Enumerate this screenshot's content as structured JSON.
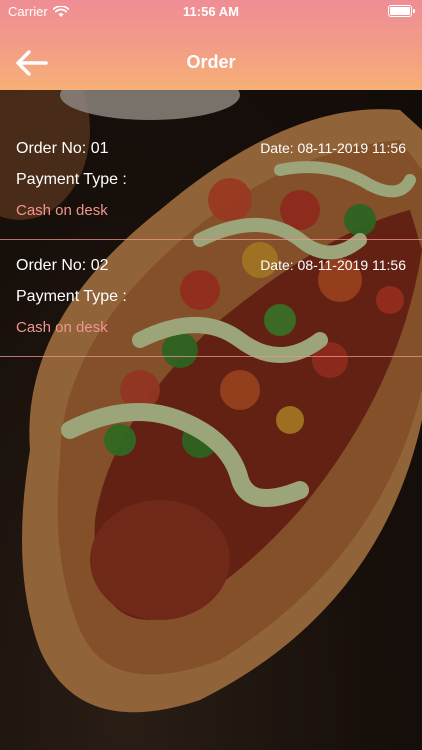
{
  "status_bar": {
    "carrier": "Carrier",
    "time": "11:56 AM"
  },
  "header": {
    "title": "Order",
    "back_icon": "arrow-left-icon"
  },
  "orders": [
    {
      "order_no": "Order No: 01",
      "date": "Date: 08-11-2019 11:56",
      "payment_label": "Payment Type :",
      "payment_value": "Cash on desk"
    },
    {
      "order_no": "Order No: 02",
      "date": "Date: 08-11-2019 11:56",
      "payment_label": "Payment Type :",
      "payment_value": "Cash on desk"
    }
  ],
  "colors": {
    "header_top": "#ef8d95",
    "header_bottom": "#f7b076",
    "payment_value": "#f2958f",
    "divider": "#f0968c"
  }
}
